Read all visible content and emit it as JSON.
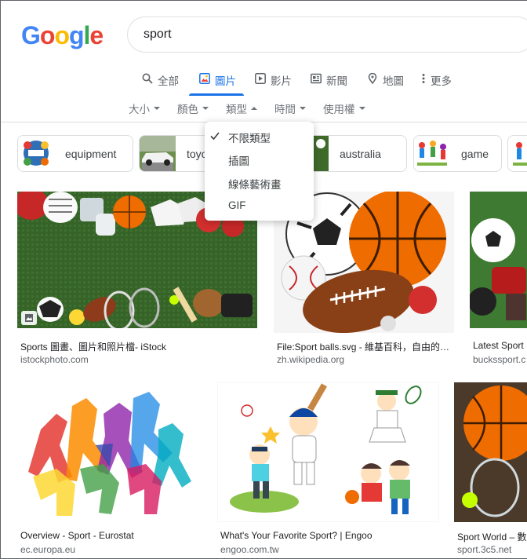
{
  "search": {
    "query": "sport"
  },
  "logo": {
    "letters": [
      "G",
      "o",
      "o",
      "g",
      "l",
      "e"
    ],
    "colors": [
      "#4285F4",
      "#EA4335",
      "#FBBC05",
      "#4285F4",
      "#34A853",
      "#EA4335"
    ]
  },
  "tabs": [
    {
      "label": "全部",
      "icon": "search-icon"
    },
    {
      "label": "圖片",
      "icon": "image-icon",
      "active": true
    },
    {
      "label": "影片",
      "icon": "play-icon"
    },
    {
      "label": "新聞",
      "icon": "news-icon"
    },
    {
      "label": "地圖",
      "icon": "map-pin-icon"
    },
    {
      "label": "更多",
      "icon": "more-vert-icon"
    }
  ],
  "filters": [
    "大小",
    "顏色",
    "類型",
    "時間",
    "使用權"
  ],
  "type_menu": {
    "items": [
      "不限類型",
      "插圖",
      "線條藝術畫",
      "GIF"
    ],
    "selected": 0
  },
  "chips": [
    "equipment",
    "toyota",
    "australia",
    "game"
  ],
  "results": [
    {
      "title": "Sports 圖畫、圖片和照片檔- iStock",
      "source": "istockphoto.com"
    },
    {
      "title": "File:Sport balls.svg - 維基百科，自由的…",
      "source": "zh.wikipedia.org"
    },
    {
      "title": "Latest Sport",
      "source": "buckssport.c"
    },
    {
      "title": "Overview - Sport - Eurostat",
      "source": "ec.europa.eu"
    },
    {
      "title": "What's Your Favorite Sport? | Engoo",
      "source": "engoo.com.tw"
    },
    {
      "title": "Sport World – 數",
      "source": "sport.3c5.net"
    }
  ],
  "colors": {
    "accent": "#1a73e8",
    "text": "#202124",
    "muted": "#5f6368"
  }
}
